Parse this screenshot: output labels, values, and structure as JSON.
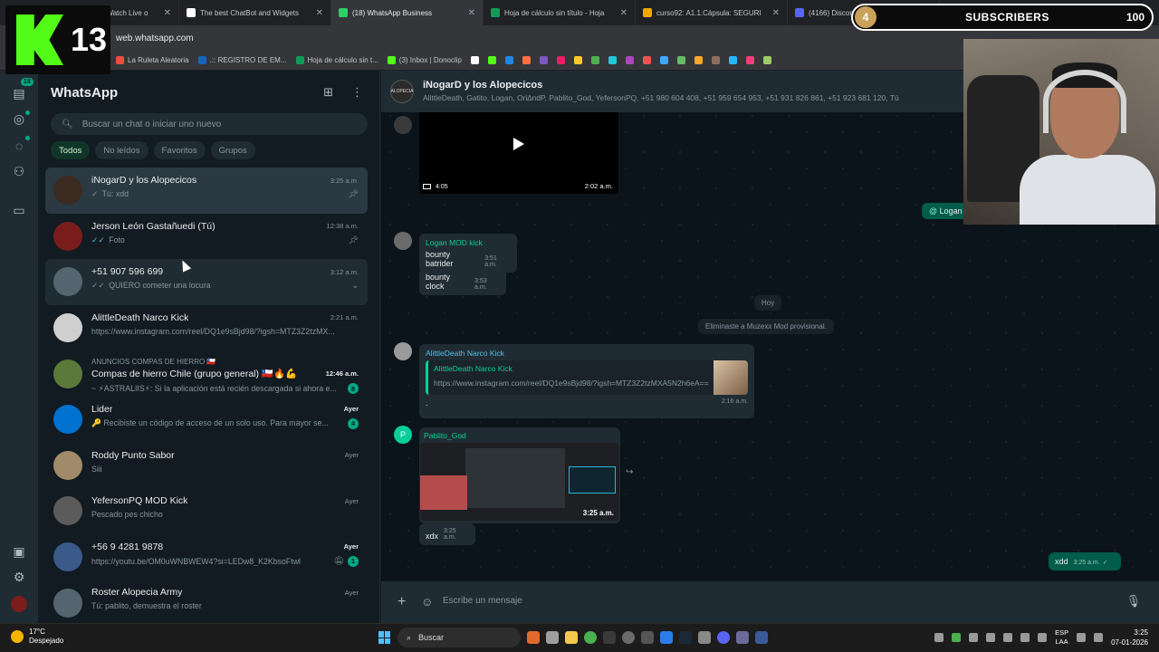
{
  "browser": {
    "tabs": [
      {
        "title": "iNogarD Stream - Watch Live o",
        "color": "#53fc18"
      },
      {
        "title": "The best ChatBot and Widgets",
        "color": "#ffffff"
      },
      {
        "title": "(18) WhatsApp Business",
        "color": "#25d366"
      },
      {
        "title": "Hoja de cálculo sin título - Hoja",
        "color": "#0f9d58"
      },
      {
        "title": "curso92: A1.1.Cápsula: SEGURI",
        "color": "#f7a600"
      },
      {
        "title": "(4166) Discord | #general | C",
        "color": "#5865f2"
      }
    ],
    "url": "web.whatsapp.com",
    "bookmarks": [
      {
        "label": "La Ruleta Aleatoria",
        "color": "#e94e3c"
      },
      {
        "label": ".:: REGISTRO DE EM...",
        "color": "#1565c0"
      },
      {
        "label": "Hoja de cálculo sin t...",
        "color": "#0f9d58"
      },
      {
        "label": "(3) Inbox | Donoclip",
        "color": "#53fc18"
      }
    ]
  },
  "overlay": {
    "kick_number": "13",
    "subscribers_label": "SUBSCRIBERS",
    "subscribers_badge": "4",
    "subscribers_count": "100"
  },
  "rail": {
    "chats_badge": "18"
  },
  "sidebar": {
    "title": "WhatsApp",
    "search_placeholder": "Buscar un chat o iniciar uno nuevo",
    "filters": [
      "Todos",
      "No leídos",
      "Favoritos",
      "Grupos"
    ],
    "chats": [
      {
        "name": "iNogarD y los Alopecicos",
        "time": "3:25 a.m.",
        "msg": "Tú: xdd",
        "ticks": "✓",
        "pinned": true,
        "avatar": "#3a2a20",
        "selected": true
      },
      {
        "name": "Jerson León Gastañuedi (Tú)",
        "time": "12:38 a.m.",
        "msg": "Foto",
        "ticks": "✓✓",
        "tick_blue": true,
        "pinned": true,
        "avatar": "#7a1c1c"
      },
      {
        "name": "+51 907 596 699",
        "time": "3:12 a.m.",
        "msg": "QUIERO cometer una locura",
        "ticks": "✓✓",
        "avatar": "#54656f",
        "hover": true
      },
      {
        "name": "AlittleDeath Narco Kick",
        "time": "2:21 a.m.",
        "msg": "https://www.instagram.com/reel/DQ1e9sBjd98/?igsh=MTZ3Z2tzMX...",
        "avatar": "#cfcfcf"
      },
      {
        "pre": "ANUNCIOS COMPAS DE HIERRO 🇨🇱",
        "name": "Compas de hierro Chile (grupo general) 🇨🇱🔥💪",
        "time": "12:46 a.m.",
        "time_bold": true,
        "msg": "~ ⚡ASTRALIIS⚡: Si la aplicación está recién descargada si ahora e...",
        "unread": "8",
        "avatar": "#5a7a3a"
      },
      {
        "name": "Lider",
        "time": "Ayer",
        "time_bold": true,
        "msg": "🔑 Recibiste un código de acceso de un solo uso. Para mayor se...",
        "unread": "4",
        "avatar": "#0071ce"
      },
      {
        "name": "Roddy Punto Sabor",
        "time": "Ayer",
        "msg": "Siii",
        "avatar": "#a08a6a"
      },
      {
        "name": "YefersonPQ MOD Kick",
        "time": "Ayer",
        "msg": "Pescado pes chicho",
        "avatar": "#5b5b5b"
      },
      {
        "name": "+56 9 4281 9878",
        "time": "Ayer",
        "time_bold": true,
        "msg": "https://youtu.be/OM0uWNBWEW4?si=LEDw8_K2KbsoFtwl",
        "unread": "1",
        "muted": true,
        "avatar": "#3a5a8a"
      },
      {
        "name": "Roster Alopecia Army",
        "time": "Ayer",
        "msg": "Tú: pablito, demuestra el roster",
        "avatar": "#54656f"
      }
    ]
  },
  "conversation": {
    "group_name": "iNogarD y los Alopecicos",
    "members": "AlittleDeath, Gatito,   Logan, Ori∆ndP, Pablito_God, YefersonPQ, +51 980 604 408, +51 959 654 953, +51 931 826 861, +51 923 681 120, Tú",
    "video": {
      "duration": "4:05",
      "time": "2:02 a.m."
    },
    "mention_label": "Logan",
    "logan": {
      "sender": "Logan MOD kick",
      "messages": [
        {
          "text": "bounty batrider",
          "time": "3:51 a.m."
        },
        {
          "text": "bounty clock",
          "time": "3:53 a.m."
        }
      ]
    },
    "day_divider": "Hoy",
    "system_msg": "Eliminaste a Muzexx Mod provisional.",
    "alittle": {
      "sender": "AlittleDeath Narco Kick",
      "quote_name": "AlittleDeath Narco Kick",
      "quote_url": "https://www.instagram.com/reel/DQ1e9sBjd98/?igsh=MTZ3Z2tzMXA5N2h6eA==",
      "text": ".",
      "time": "2:16 a.m."
    },
    "pablito": {
      "sender": "Pablito_God",
      "avatar_letter": "P",
      "image_time": "3:25 a.m.",
      "text": "xdx",
      "time": "3:25 a.m."
    },
    "outgoing": {
      "text": "xdd",
      "time": "3:25 a.m."
    },
    "compose_placeholder": "Escribe un mensaje"
  },
  "taskbar": {
    "temp": "17°C",
    "weather": "Despejado",
    "search": "Buscar",
    "lang1": "ESP",
    "lang2": "LAA",
    "time": "3:25",
    "date": "07-01-2026"
  }
}
